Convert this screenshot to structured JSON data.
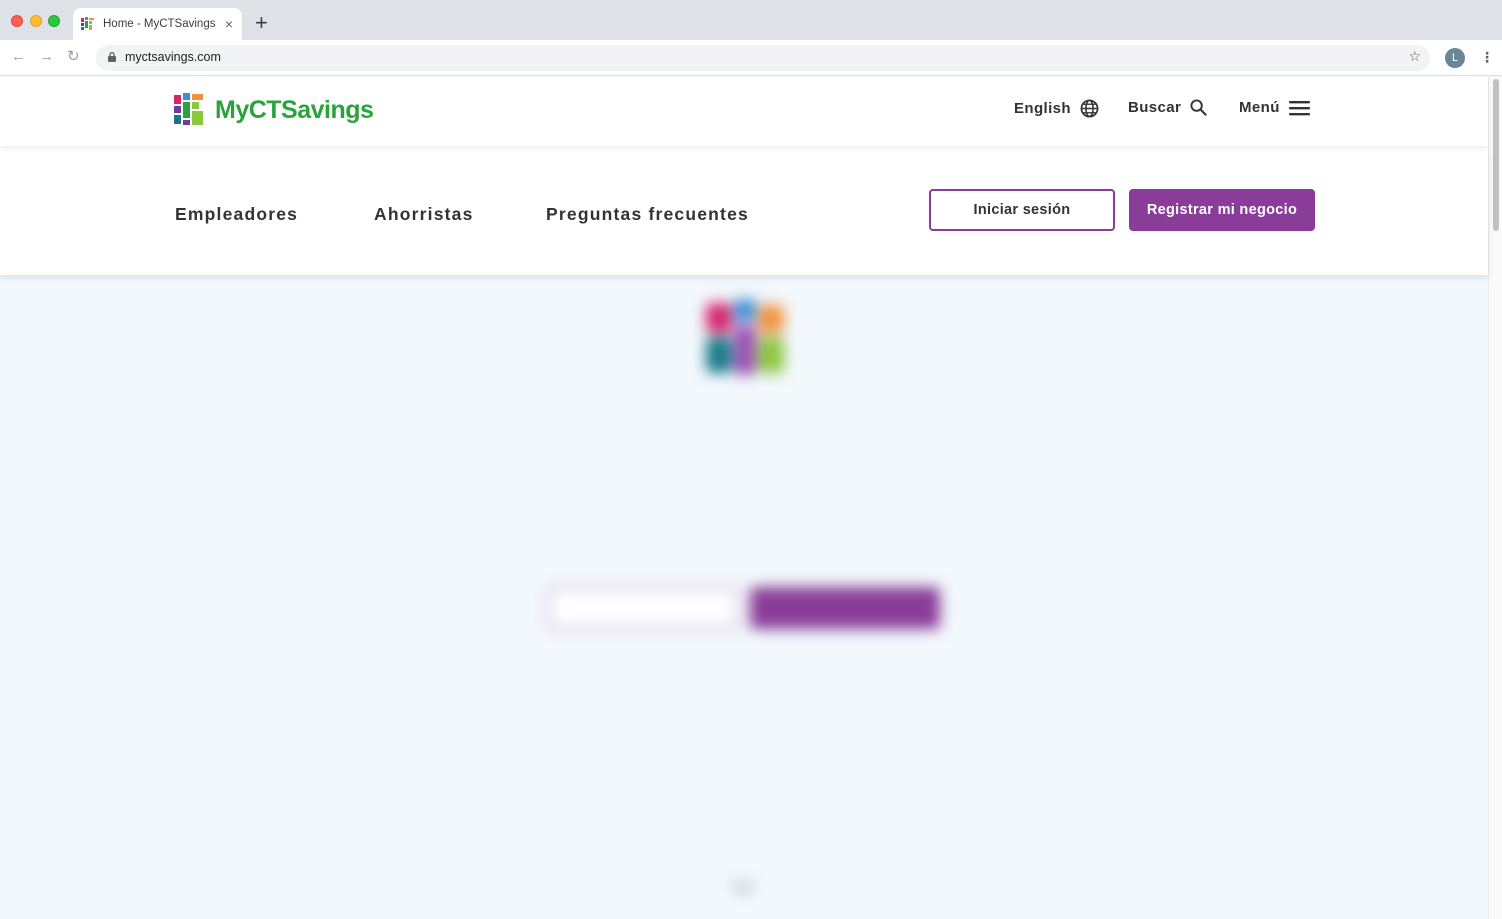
{
  "browser": {
    "tab_title": "Home - MyCTSavings",
    "tab_close": "×",
    "new_tab": "+",
    "url": "myctsavings.com",
    "profile_initial": "L"
  },
  "header": {
    "logo_text": "MyCTSavings",
    "language_label": "English",
    "search_label": "Buscar",
    "menu_label": "Menú"
  },
  "nav": {
    "links": [
      "Empleadores",
      "Ahorristas",
      "Preguntas frecuentes"
    ],
    "login_button": "Iniciar sesión",
    "register_button": "Registrar mi negocio"
  },
  "colors": {
    "brand_purple": "#8a3d98",
    "brand_green": "#2aa33a",
    "page_bg": "#f2f8fc"
  }
}
